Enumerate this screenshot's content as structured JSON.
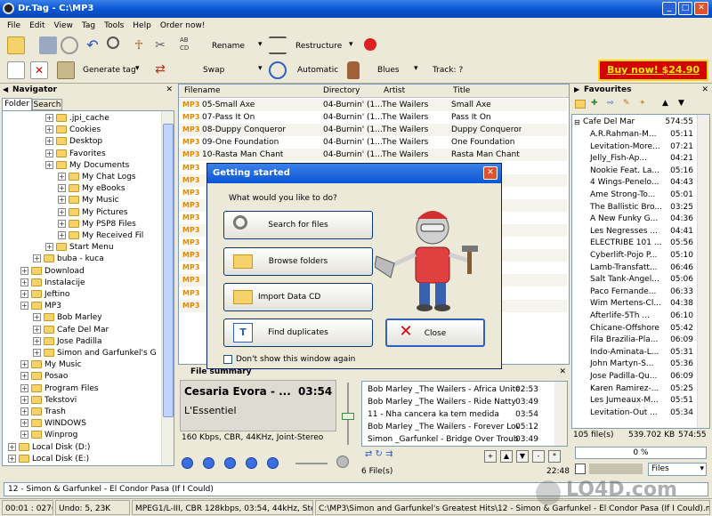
{
  "window": {
    "title": "Dr.Tag - C:\\MP3",
    "min": "_",
    "max": "□",
    "close": "✕"
  },
  "menu": [
    "File",
    "Edit",
    "View",
    "Tag",
    "Tools",
    "Help",
    "Order now!"
  ],
  "toolbar": {
    "rename": "Rename",
    "restructure": "Restructure",
    "generate_tag": "Generate tag",
    "swap": "Swap",
    "automatic": "Automatic",
    "genre": "Blues",
    "track": "Track: ?",
    "buy_now": "Buy now! $24.90",
    "abcd": "AB CD"
  },
  "navigator": {
    "title": "Navigator",
    "tabs": [
      "Folder",
      "Search"
    ],
    "tree": [
      {
        "label": ".jpi_cache",
        "indent": 3
      },
      {
        "label": "Cookies",
        "indent": 3
      },
      {
        "label": "Desktop",
        "indent": 3
      },
      {
        "label": "Favorites",
        "indent": 3
      },
      {
        "label": "My Documents",
        "indent": 3
      },
      {
        "label": "My Chat Logs",
        "indent": 4
      },
      {
        "label": "My eBooks",
        "indent": 4
      },
      {
        "label": "My Music",
        "indent": 4
      },
      {
        "label": "My Pictures",
        "indent": 4
      },
      {
        "label": "My PSP8 Files",
        "indent": 4
      },
      {
        "label": "My Received Fil",
        "indent": 4
      },
      {
        "label": "Start Menu",
        "indent": 3
      },
      {
        "label": "buba - kuca",
        "indent": 2
      },
      {
        "label": "Download",
        "indent": 1
      },
      {
        "label": "Instalacije",
        "indent": 1
      },
      {
        "label": "Jeftino",
        "indent": 1
      },
      {
        "label": "MP3",
        "indent": 1
      },
      {
        "label": "Bob Marley",
        "indent": 2
      },
      {
        "label": "Cafe Del Mar",
        "indent": 2
      },
      {
        "label": "Jose Padilla",
        "indent": 2
      },
      {
        "label": "Simon and Garfunkel's G",
        "indent": 2
      },
      {
        "label": "My Music",
        "indent": 1
      },
      {
        "label": "Posao",
        "indent": 1
      },
      {
        "label": "Program Files",
        "indent": 1
      },
      {
        "label": "Tekstovi",
        "indent": 1
      },
      {
        "label": "Trash",
        "indent": 1
      },
      {
        "label": "WINDOWS",
        "indent": 1
      },
      {
        "label": "Winprog",
        "indent": 1
      },
      {
        "label": "Local Disk (D:)",
        "indent": 0
      },
      {
        "label": "Local Disk (E:)",
        "indent": 0
      }
    ]
  },
  "filelist": {
    "headers": [
      "Filename",
      "Directory",
      "Artist",
      "Title"
    ],
    "rows": [
      {
        "tag": "MP3",
        "file": "05-Small Axe",
        "dir": "04-Burnin' (1...",
        "artist": "The Wailers",
        "title": "Small Axe"
      },
      {
        "tag": "MP3",
        "file": "07-Pass It On",
        "dir": "04-Burnin' (1...",
        "artist": "The Wailers",
        "title": "Pass It On"
      },
      {
        "tag": "MP3",
        "file": "08-Duppy Conqueror",
        "dir": "04-Burnin' (1...",
        "artist": "The Wailers",
        "title": "Duppy Conqueror"
      },
      {
        "tag": "MP3",
        "file": "09-One Foundation",
        "dir": "04-Burnin' (1...",
        "artist": "The Wailers",
        "title": "One Foundation"
      },
      {
        "tag": "MP3",
        "file": "10-Rasta Man Chant",
        "dir": "04-Burnin' (1...",
        "artist": "The Wailers",
        "title": "Rasta Man Chant"
      },
      {
        "tag": "MP3",
        "file": "",
        "dir": "",
        "artist": "",
        "title": "rever I Ma..."
      },
      {
        "tag": "MP3",
        "file": "",
        "dir": "",
        "artist": "",
        "title": "Bridge So..."
      },
      {
        "tag": "MP3",
        "file": "",
        "dir": "",
        "artist": "",
        "title": "lence"
      },
      {
        "tag": "MP3",
        "file": "",
        "dir": "",
        "artist": "",
        "title": ""
      },
      {
        "tag": "MP3",
        "file": "",
        "dir": "",
        "artist": "",
        "title": "ir-Canticle"
      },
      {
        "tag": "MP3",
        "file": "",
        "dir": "",
        "artist": "",
        "title": "ubled Water"
      },
      {
        "tag": "MP3",
        "file": "",
        "dir": "",
        "artist": "",
        "title": ""
      },
      {
        "tag": "MP3",
        "file": "",
        "dir": "",
        "artist": "",
        "title": "(If I Could)"
      },
      {
        "tag": "MP3",
        "file": "",
        "dir": "",
        "artist": "",
        "title": ""
      },
      {
        "tag": "MP3",
        "file": "",
        "dir": "",
        "artist": "",
        "title": ""
      },
      {
        "tag": "MP3",
        "file": "",
        "dir": "",
        "artist": "",
        "title": "tem medida"
      },
      {
        "tag": "MP3",
        "file": "",
        "dir": "",
        "artist": "",
        "title": ""
      }
    ]
  },
  "dialog": {
    "title": "Getting started",
    "question": "What would you like to do?",
    "search": "Search for files",
    "browse": "Browse folders",
    "import": "Import Data CD",
    "duplicates": "Find duplicates",
    "close": "Close",
    "dont_show": "Don't show this window again"
  },
  "file_summary": {
    "title": "File summary",
    "artist": "Cesaria Evora - ...",
    "time": "03:54",
    "album": "L'Essentiel",
    "info": "160 Kbps, CBR, 44KHz, Joint-Stereo"
  },
  "playlist": {
    "rows": [
      {
        "name": "Bob Marley _The Wailers - Africa Unite",
        "time": "02:53"
      },
      {
        "name": "Bob Marley _The Wailers - Ride Natty Ride",
        "time": "03:49"
      },
      {
        "name": "11 - Nha cancera ka tem medida",
        "time": "03:54"
      },
      {
        "name": "Bob Marley _The Wailers - Forever Lovin...",
        "time": "05:12"
      },
      {
        "name": "Simon _Garfunkel - Bridge Over Troubled...",
        "time": "03:49"
      }
    ],
    "count": "6 File(s)",
    "total": "22:48"
  },
  "favourites": {
    "title": "Favourites",
    "group": {
      "name": "Cafe Del Mar",
      "time": "574:55"
    },
    "rows": [
      {
        "name": "A.R.Rahman-M...",
        "time": "05:11"
      },
      {
        "name": "Levitation-More...",
        "time": "07:21"
      },
      {
        "name": "Jelly_Fish-Ap...",
        "time": "04:21"
      },
      {
        "name": "Nookie Feat. La...",
        "time": "05:16"
      },
      {
        "name": "4 Wings-Penelo...",
        "time": "04:43"
      },
      {
        "name": "Ame Strong-To...",
        "time": "05:01"
      },
      {
        "name": "The Ballistic Bro...",
        "time": "03:25"
      },
      {
        "name": "A New Funky G...",
        "time": "04:36"
      },
      {
        "name": "Les Negresses ...",
        "time": "04:41"
      },
      {
        "name": "ELECTRIBE 101 ...",
        "time": "05:56"
      },
      {
        "name": "Cyberlift-Pojo P...",
        "time": "05:10"
      },
      {
        "name": "Lamb-Transfatt...",
        "time": "06:46"
      },
      {
        "name": "Salt Tank-Angel...",
        "time": "05:06"
      },
      {
        "name": "Paco Fernande...",
        "time": "06:33"
      },
      {
        "name": "Wim Mertens-Cl...",
        "time": "04:38"
      },
      {
        "name": "Afterlife-5Th ...",
        "time": "06:10"
      },
      {
        "name": "Chicane-Offshore",
        "time": "05:42"
      },
      {
        "name": "Fila Brazilia-Pla...",
        "time": "06:09"
      },
      {
        "name": "Indo-Aminata-L...",
        "time": "05:31"
      },
      {
        "name": "John Martyn-S...",
        "time": "05:36"
      },
      {
        "name": "Jose Padilla-Qu...",
        "time": "06:09"
      },
      {
        "name": "Karen Ramirez-...",
        "time": "05:25"
      },
      {
        "name": "Les Jumeaux-M...",
        "time": "05:51"
      },
      {
        "name": "Levitation-Out ...",
        "time": "05:34"
      }
    ],
    "count": "105 file(s)",
    "size": "539.702 KB",
    "total_time": "574:55",
    "progress": "0 %",
    "filter": "Files"
  },
  "bottom_path": "12 - Simon & Garfunkel - El Condor Pasa (If I Could)",
  "status": {
    "pos": "00:01 : 0276",
    "undo": "Undo: 5, 23K",
    "codec": "MPEG1/L-III, CBR 128kbps, 03:54, 44kHz, Stereo",
    "path": "C:\\MP3\\Simon and Garfunkel's Greatest Hits\\12 - Simon & Garfunkel - El Condor Pasa (If I Could).mp3"
  },
  "watermark": "LO4D.com"
}
